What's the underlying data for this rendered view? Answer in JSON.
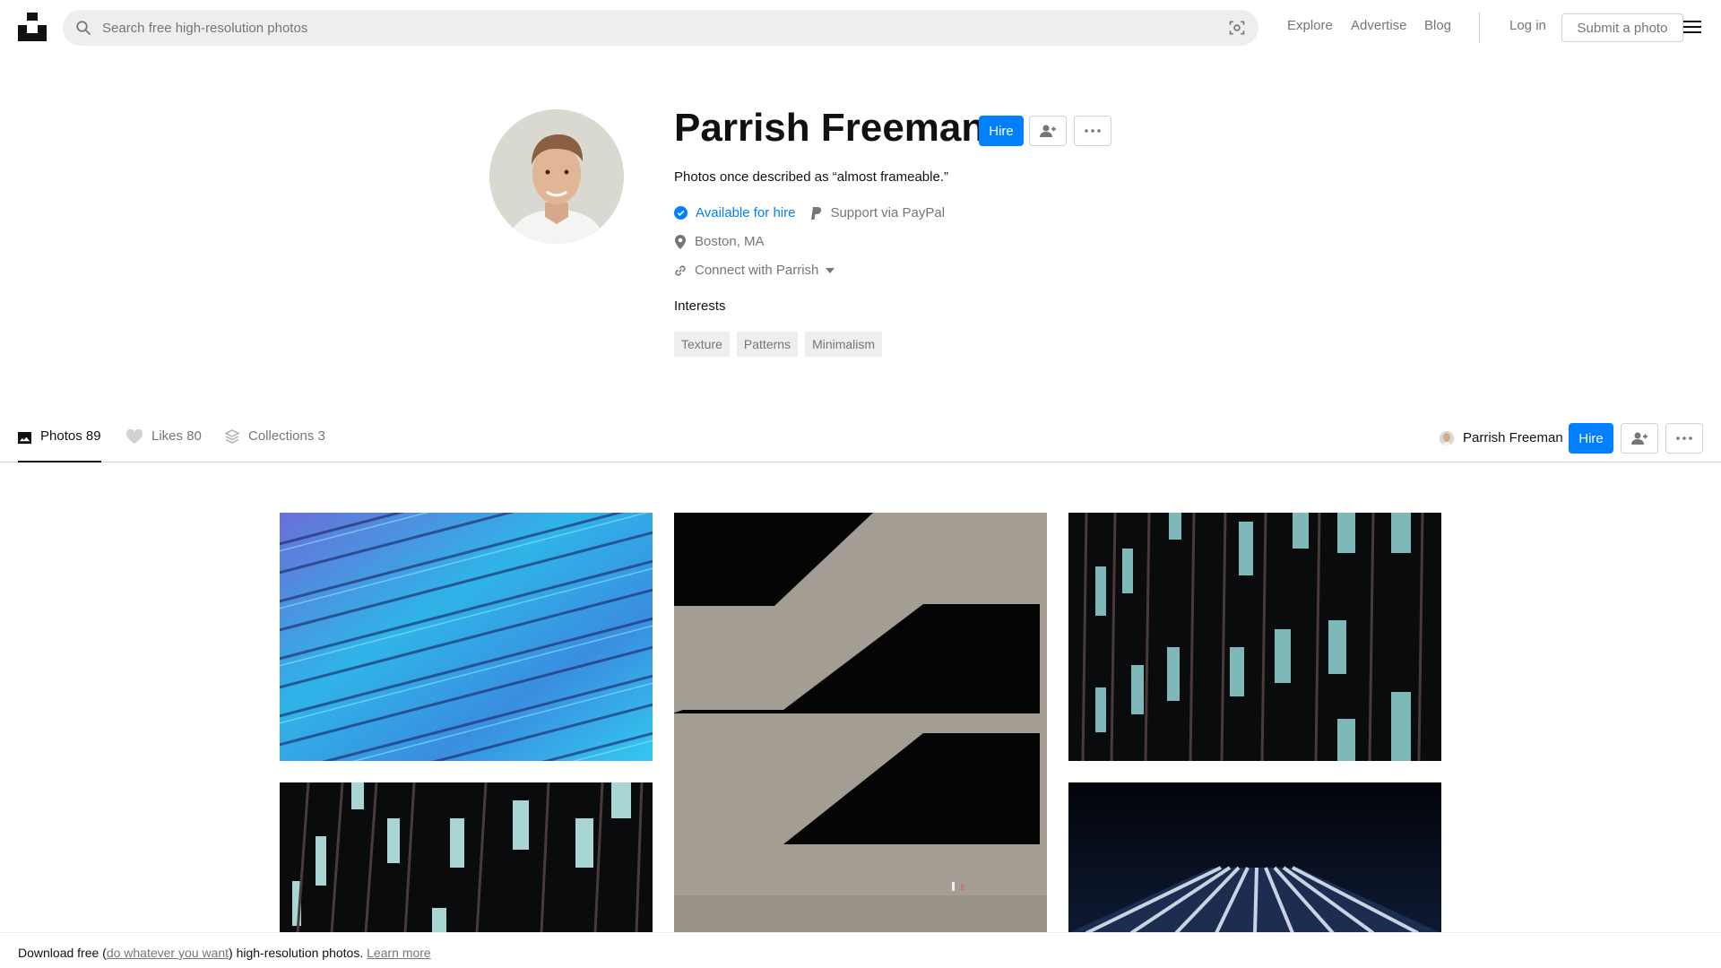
{
  "header": {
    "search": {
      "placeholder": "Search free high-resolution photos"
    },
    "nav": {
      "explore": "Explore",
      "advertise": "Advertise",
      "blog": "Blog",
      "login": "Log in",
      "submit": "Submit a photo"
    }
  },
  "profile": {
    "name": "Parrish Freeman",
    "hire_label": "Hire",
    "bio": "Photos once described as “almost frameable.”",
    "available": "Available for hire",
    "paypal": "Support via PayPal",
    "location": "Boston, MA",
    "connect": "Connect with Parrish",
    "interests_title": "Interests",
    "interests": [
      "Texture",
      "Patterns",
      "Minimalism"
    ]
  },
  "tabs": {
    "photos": {
      "label": "Photos",
      "count": "89"
    },
    "likes": {
      "label": "Likes",
      "count": "80"
    },
    "collections": {
      "label": "Collections",
      "count": "3"
    }
  },
  "sticky": {
    "name": "Parrish Freeman",
    "hire_label": "Hire"
  },
  "footer": {
    "prefix": "Download free (",
    "link": "do whatever you want",
    "middle": ") high-resolution photos. ",
    "learn_more": "Learn more"
  },
  "colors": {
    "accent": "#007fff",
    "muted": "#767676",
    "border": "#d1d1d1",
    "surface": "#eeeeee"
  },
  "icons": [
    "unsplash-logo-icon",
    "search-icon",
    "visual-search-icon",
    "menu-icon",
    "follow-icon",
    "more-icon",
    "verified-icon",
    "paypal-icon",
    "location-pin-icon",
    "link-icon",
    "chevron-down-icon",
    "photos-icon",
    "heart-icon",
    "collections-icon"
  ]
}
